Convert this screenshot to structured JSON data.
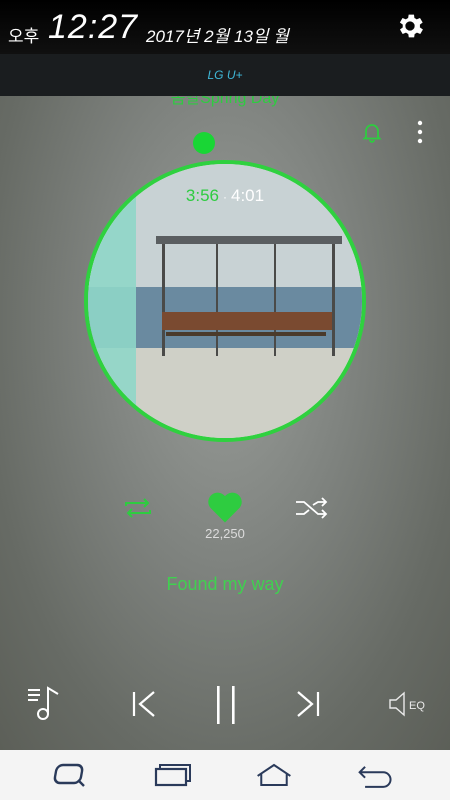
{
  "status_bar": {
    "ampm": "오후",
    "time": "12:27",
    "date": "2017년 2월 13일 월",
    "settings_icon": "gear-icon"
  },
  "carrier": {
    "name": "LG U+"
  },
  "player": {
    "album_title": "봄날Spring Day",
    "elapsed": "3:56",
    "separator": "·",
    "total": "4:01",
    "likes": "22,250",
    "song_title": "Found my way",
    "accent": "#2ecc40"
  },
  "controls": {
    "eq_label": "EQ"
  },
  "icons": [
    "bell-icon",
    "more-vert-icon",
    "repeat-icon",
    "heart-icon",
    "shuffle-icon",
    "playlist-icon",
    "previous-icon",
    "pause-icon",
    "next-icon",
    "equalizer-icon",
    "search-icon",
    "recent-apps-icon",
    "home-icon",
    "back-icon"
  ]
}
